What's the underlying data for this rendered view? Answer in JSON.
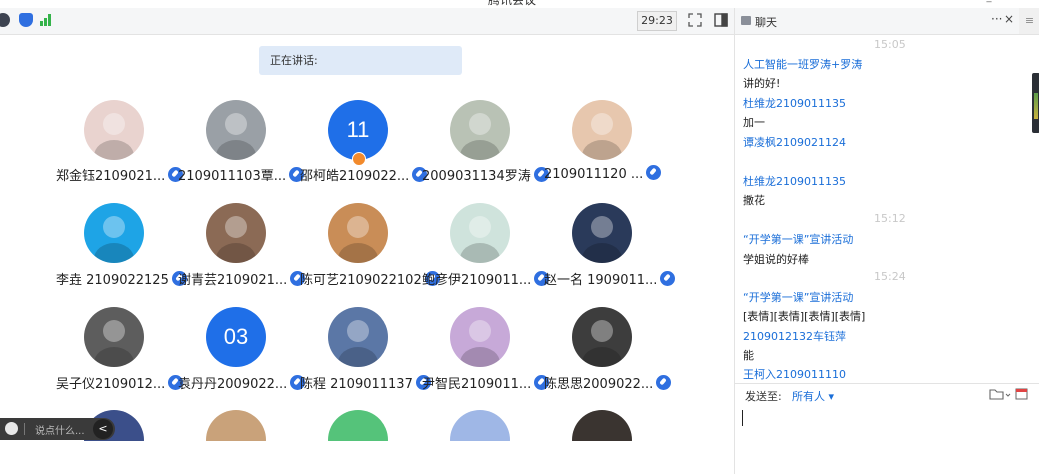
{
  "window": {
    "title": "腾讯会议",
    "controls": "_ ×"
  },
  "toolbar": {
    "timer": "29:23"
  },
  "speaking": {
    "label": "正在讲话:"
  },
  "participants": [
    {
      "name": "郑金钰2109021...",
      "avatar": "photo",
      "color": "#e9d3cf"
    },
    {
      "name": "2109011103覃...",
      "avatar": "photo",
      "color": "#9aa0a6"
    },
    {
      "name": "邵柯皓2109022...",
      "avatar": "11",
      "color": "#1f6fe8"
    },
    {
      "name": "2009031134罗涛",
      "avatar": "photo",
      "color": "#b9c2b5"
    },
    {
      "name": "2109011120 ...",
      "avatar": "photo",
      "color": "#e7c7ae"
    },
    {
      "name": "李垚 2109022125",
      "avatar": "photo",
      "color": "#1ea4e6"
    },
    {
      "name": "谢青芸2109021...",
      "avatar": "photo",
      "color": "#8b6a55"
    },
    {
      "name": "陈可艺2109022102",
      "avatar": "photo",
      "color": "#c98d57"
    },
    {
      "name": "鲍彦伊2109011...",
      "avatar": "photo",
      "color": "#cfe3dc"
    },
    {
      "name": "赵一名 1909011...",
      "avatar": "photo",
      "color": "#2a3a5a"
    },
    {
      "name": "吴子仪2109012...",
      "avatar": "photo",
      "color": "#5d5d5d"
    },
    {
      "name": "袁丹丹2009022...",
      "avatar": "03",
      "color": "#1f6fe8"
    },
    {
      "name": "陈程 2109011137",
      "avatar": "photo",
      "color": "#5b77a6"
    },
    {
      "name": "尹智民2109011...",
      "avatar": "photo",
      "color": "#c7a9d8"
    },
    {
      "name": "陈思思2009022...",
      "avatar": "photo",
      "color": "#3d3d3d"
    }
  ],
  "chat_pill": {
    "placeholder": "说点什么..."
  },
  "chat": {
    "title": "聊天",
    "more": "···",
    "close": "×",
    "side_menu": "≡",
    "messages": [
      {
        "kind": "time",
        "text": "15:05"
      },
      {
        "kind": "sender",
        "text": "人工智能一班罗涛+罗涛"
      },
      {
        "kind": "body",
        "text": "讲的好!"
      },
      {
        "kind": "sender",
        "text": "杜维龙2109011135"
      },
      {
        "kind": "body",
        "text": "加一"
      },
      {
        "kind": "sender",
        "text": "谭凌枫2109021124"
      },
      {
        "kind": "body",
        "text": ""
      },
      {
        "kind": "sender",
        "text": "杜维龙2109011135"
      },
      {
        "kind": "body",
        "text": "撒花"
      },
      {
        "kind": "time",
        "text": "15:12"
      },
      {
        "kind": "sender",
        "text": "“开学第一课”宣讲活动"
      },
      {
        "kind": "body",
        "text": "学姐说的好棒"
      },
      {
        "kind": "time",
        "text": "15:24"
      },
      {
        "kind": "sender",
        "text": "“开学第一课”宣讲活动"
      },
      {
        "kind": "body",
        "text": "[表情][表情][表情][表情]"
      },
      {
        "kind": "sender",
        "text": "2109012132车钰萍"
      },
      {
        "kind": "body",
        "text": "能"
      },
      {
        "kind": "sender",
        "text": "王柯入2109011110"
      }
    ],
    "send_label": "发送至:",
    "send_to": "所有人 ▾"
  }
}
